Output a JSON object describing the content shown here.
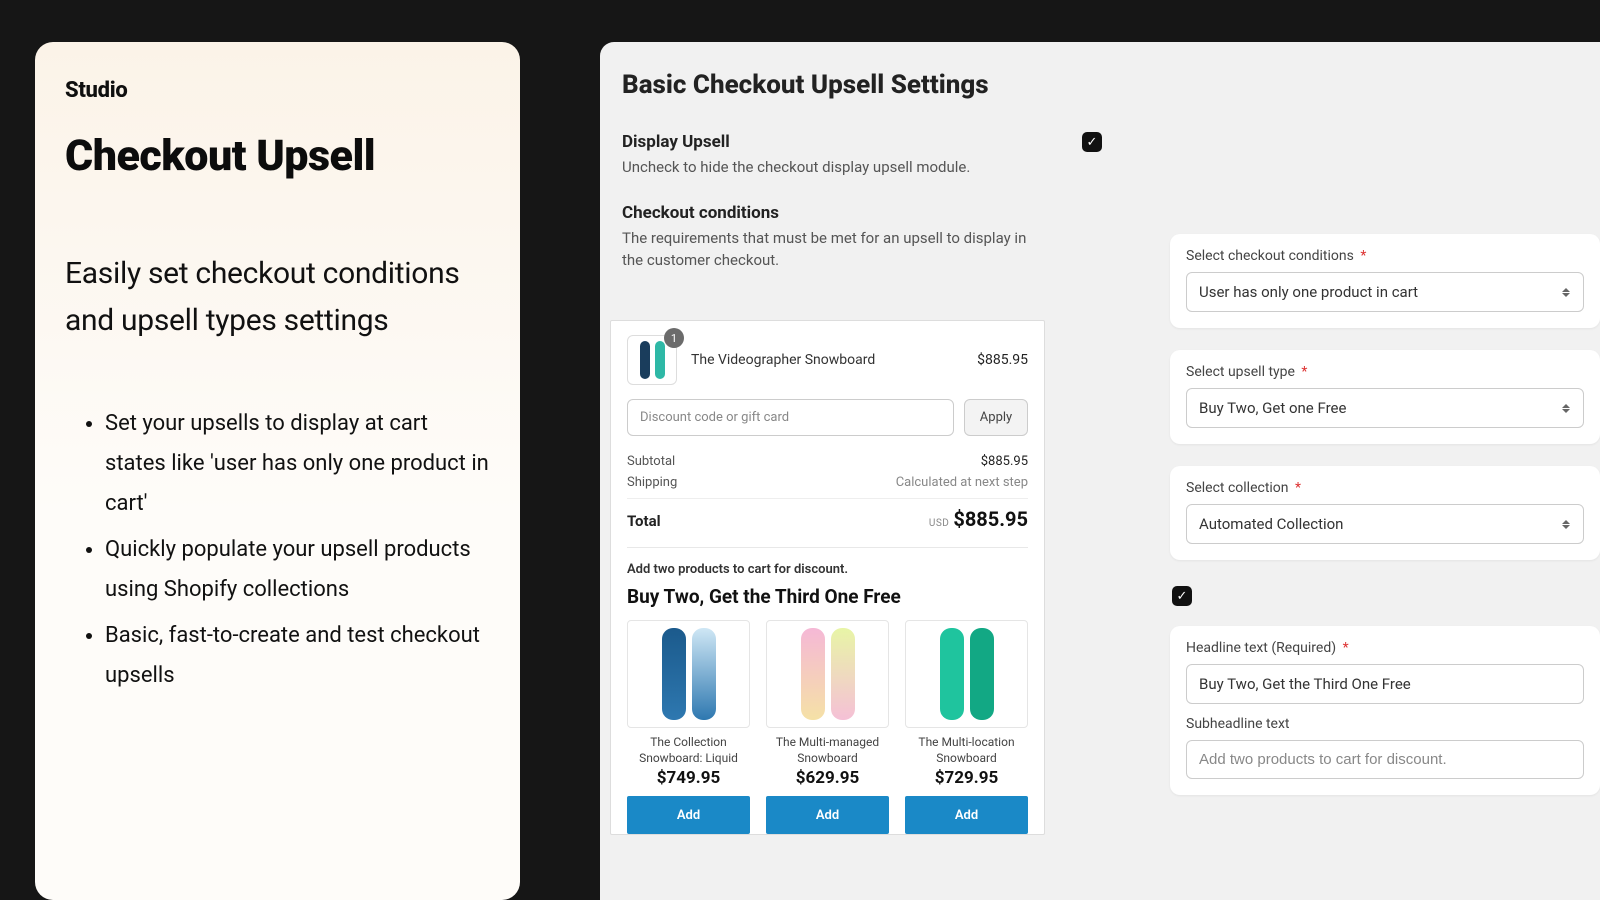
{
  "brand": "Studio",
  "hero": {
    "title": "Checkout Upsell",
    "subtitle": "Easily set checkout conditions and upsell types settings",
    "bullets": [
      "Set your upsells to display at cart states like 'user has only one product in cart'",
      "Quickly populate your upsell products using Shopify collections",
      "Basic, fast-to-create and test checkout upsells"
    ]
  },
  "settings": {
    "title": "Basic Checkout Upsell Settings",
    "display_upsell": {
      "label": "Display Upsell",
      "help": "Uncheck to hide the checkout display upsell module.",
      "checked": true
    },
    "checkout_conditions": {
      "label": "Checkout conditions",
      "help": "The requirements that must be met for an upsell to display in the customer checkout."
    },
    "forms": {
      "conditions": {
        "label": "Select checkout conditions",
        "value": "User has only one product in cart"
      },
      "upsell_type": {
        "label": "Select upsell type",
        "value": "Buy Two, Get one Free"
      },
      "collection": {
        "label": "Select collection",
        "value": "Automated Collection"
      },
      "extra_checked": true,
      "headline": {
        "label": "Headline text (Required)",
        "value": "Buy Two, Get the Third One Free"
      },
      "subheadline": {
        "label": "Subheadline text",
        "placeholder": "Add two products to cart for discount."
      }
    }
  },
  "checkout": {
    "cart_item": {
      "name": "The Videographer Snowboard",
      "qty": "1",
      "price": "$885.95"
    },
    "discount_placeholder": "Discount code or gift card",
    "apply_label": "Apply",
    "subtotal": {
      "label": "Subtotal",
      "value": "$885.95"
    },
    "shipping": {
      "label": "Shipping",
      "value": "Calculated at next step"
    },
    "total": {
      "label": "Total",
      "currency": "USD",
      "value": "$885.95"
    },
    "upsell_hint": "Add two products to cart for discount.",
    "upsell_headline": "Buy Two, Get the Third One Free",
    "upsell_products": [
      {
        "name": "The Collection Snowboard: Liquid",
        "price": "$749.95"
      },
      {
        "name": "The Multi-managed Snowboard",
        "price": "$629.95"
      },
      {
        "name": "The Multi-location Snowboard",
        "price": "$729.95"
      }
    ],
    "add_label": "Add"
  }
}
